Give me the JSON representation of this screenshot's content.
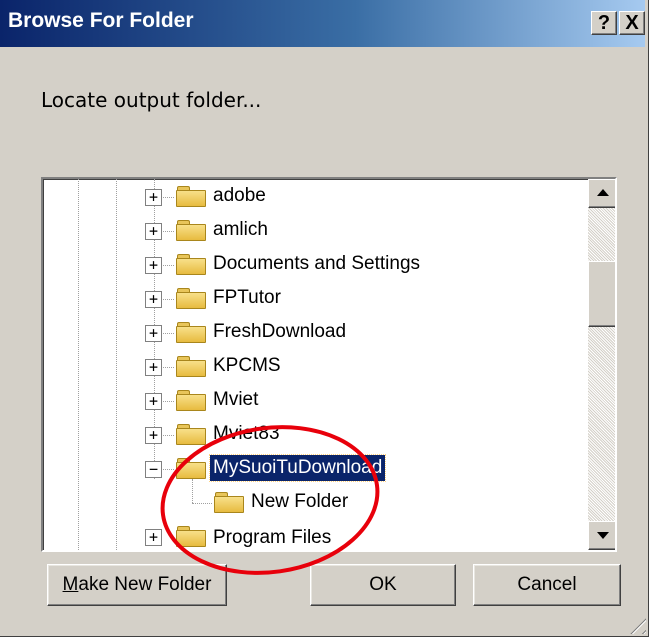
{
  "window": {
    "title": "Browse For Folder",
    "help_label": "?",
    "close_label": "X"
  },
  "prompt": "Locate output folder...",
  "tree": {
    "items": [
      {
        "label": "adobe",
        "expander": "+"
      },
      {
        "label": "amlich",
        "expander": "+"
      },
      {
        "label": "Documents and Settings",
        "expander": "+"
      },
      {
        "label": "FPTutor",
        "expander": "+"
      },
      {
        "label": "FreshDownload",
        "expander": "+"
      },
      {
        "label": "KPCMS",
        "expander": "+"
      },
      {
        "label": "Mviet",
        "expander": "+"
      },
      {
        "label": "Mviet83",
        "expander": "+"
      },
      {
        "label": "MySuoiTuDownload",
        "expander": "−",
        "selected": true
      },
      {
        "label": "New Folder",
        "expander": ""
      }
    ],
    "partial_label": "Program Files"
  },
  "buttons": {
    "new_folder_prefix": "M",
    "new_folder_rest": "ake New Folder",
    "ok": "OK",
    "cancel": "Cancel"
  },
  "colors": {
    "titlebar_start": "#0a246a",
    "selection": "#0a246a",
    "annotation_circle": "#e8000b"
  }
}
